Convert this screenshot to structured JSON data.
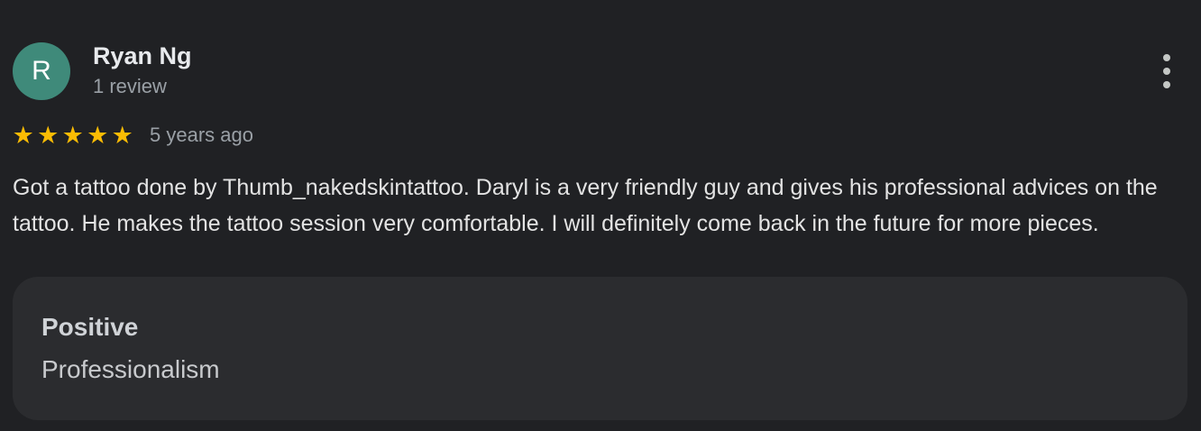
{
  "review": {
    "avatar_letter": "R",
    "author_name": "Ryan Ng",
    "author_review_count": "1 review",
    "rating": 5,
    "rating_max": 5,
    "stars": [
      "★",
      "★",
      "★",
      "★",
      "★"
    ],
    "time_ago": "5 years ago",
    "text": "Got a tattoo done by Thumb_nakedskintattoo. Daryl is a very friendly guy and gives his professional advices on the tattoo. He makes the tattoo session very comfortable. I will definitely come back in the future for more pieces.",
    "attribute": {
      "label": "Positive",
      "value": "Professionalism"
    },
    "colors": {
      "avatar": "#3f8a7a",
      "star": "#fbbc04",
      "background": "#202124",
      "card": "#2b2c2f"
    },
    "icons": {
      "more": "more-vert-icon",
      "star": "star-icon"
    }
  }
}
